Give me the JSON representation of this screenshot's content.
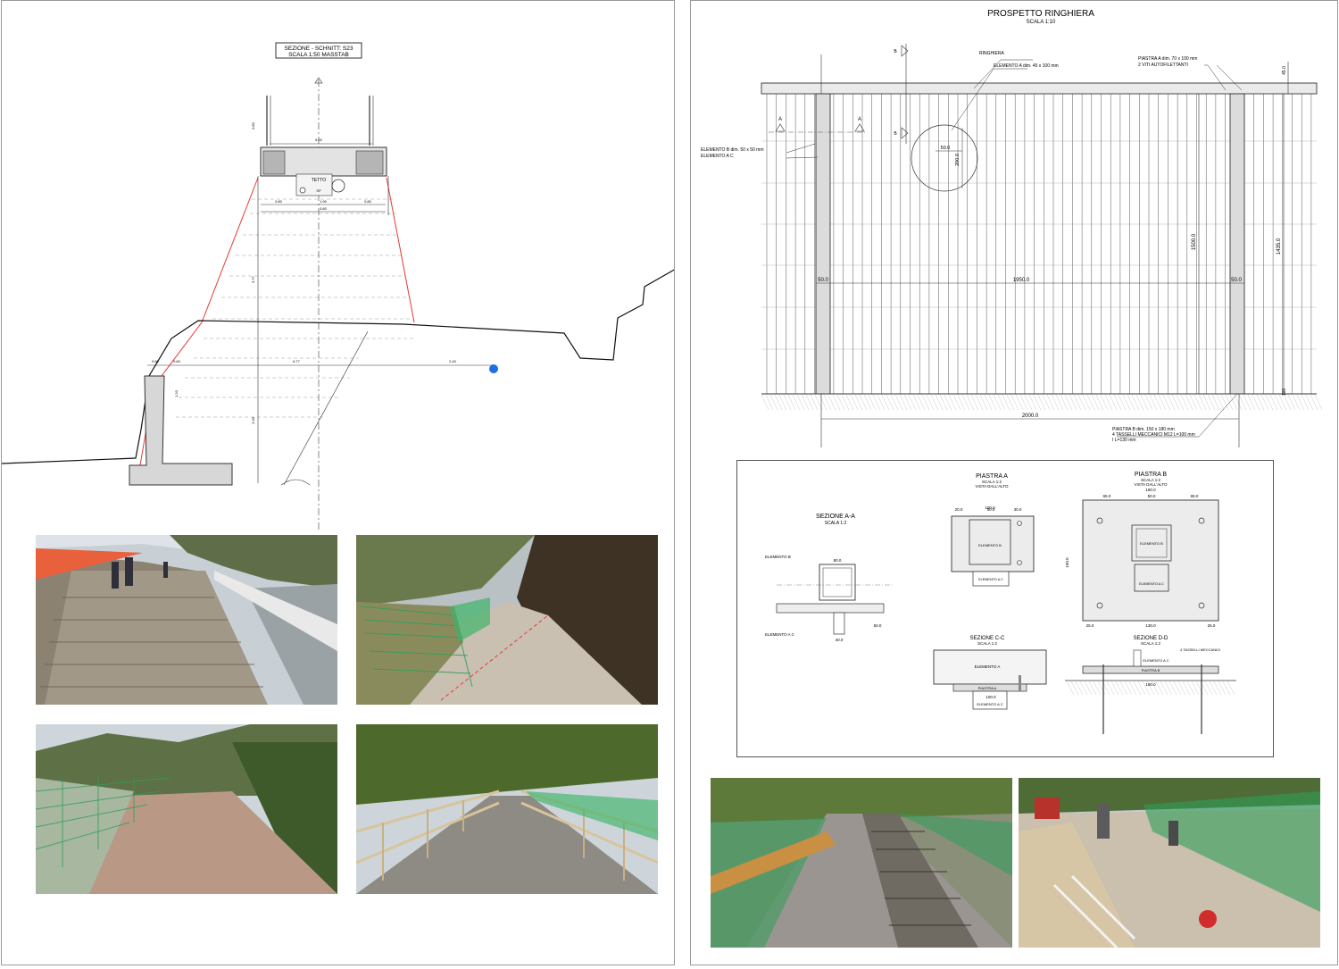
{
  "left_sheet": {
    "section_title": "SEZIONE - SCHNITT: S23",
    "section_scale": "SCALA 1:50 MASSTAB",
    "label_tetto": "TETTO",
    "label_sp": "SP",
    "dims": {
      "top_width": "5.00",
      "mid_a": "0.80",
      "mid_b": "1.90",
      "mid_c": "0.80",
      "base_width": "3.80",
      "left_a": "0.50",
      "left_b": "0.60",
      "ground_a": "6.77",
      "ground_b": "2.40",
      "vertical_a": "0.80",
      "vertical_b": "3.77",
      "vertical_c": "1.20",
      "vertical_d": "2.00"
    }
  },
  "right_sheet": {
    "title": "PROSPETTO RINGHIERA",
    "scale": "SCALA 1:10",
    "labels": {
      "ringhiera": "RINGHIERA",
      "elemento_a": "ELEMENTO A dim. 45 x 100 mm",
      "piastra_a": "PIASTRA A dim. 70 x 100 mm",
      "viti": "2 VITI AUTOFILETTANTI",
      "elemento_b": "ELEMENTO B dim. 50 x 50 mm",
      "elemento_ac": "ELEMENTO A C",
      "piastra_b": "PIASTRA B dim. 150 x 180 mm",
      "tasselli": "4 TASSELLI MECCANICI M12 L=100 mm",
      "l130": "I L=130 mm",
      "section_a": "A",
      "section_b": "B"
    },
    "dims": {
      "d50_top": "50.0",
      "d200": "200.0",
      "d50_left": "50.0",
      "d1950": "1950.0",
      "d50_right": "50.0",
      "d1500": "1500.0",
      "d1435": "1435.0",
      "d45": "45.0",
      "d100": "100",
      "d2000": "2000.0"
    },
    "details": {
      "piastra_a_title": "PIASTRA A",
      "piastra_a_scale": "SCALA 1:2",
      "piastra_a_view": "VISTA DALL'ALTO",
      "piastra_b_title": "PIASTRA B",
      "piastra_b_scale": "SCALA 1:2",
      "piastra_b_view": "VISTA DALL'ALTO",
      "sezione_aa_title": "SEZIONE A-A",
      "sezione_aa_scale": "SCALA 1:2",
      "sezione_cc_title": "SEZIONE C-C",
      "sezione_cc_scale": "SCALA 1:2",
      "sezione_dd_title": "SEZIONE D-D",
      "sezione_dd_scale": "SCALA 1:2",
      "elemento_b": "ELEMENTO B",
      "elemento_ac": "ELEMENTO A C",
      "elemento_a": "ELEMENTO A",
      "piastra_a": "PIASTRA A",
      "piastra_b": "PIASTRA B",
      "tasselli": "4 TASSELLI MECCANICI",
      "dim_100": "100.0",
      "dim_180": "180.0",
      "dim_150": "150.0",
      "dim_130": "130.0",
      "dim_80": "80.0",
      "dim_65": "65.0",
      "dim_50": "50.0",
      "dim_40": "40.0",
      "dim_25": "25.0",
      "dim_20": "20.0",
      "dim_30": "30.0"
    }
  },
  "colors": {
    "line": "#333333",
    "red_line": "#e53935",
    "accent_dot": "#1e6fe0",
    "net_green": "#2f9e58",
    "sky": "#cfd8e0",
    "vegetation": "#4c6b2c",
    "concrete": "#b9aea0"
  }
}
